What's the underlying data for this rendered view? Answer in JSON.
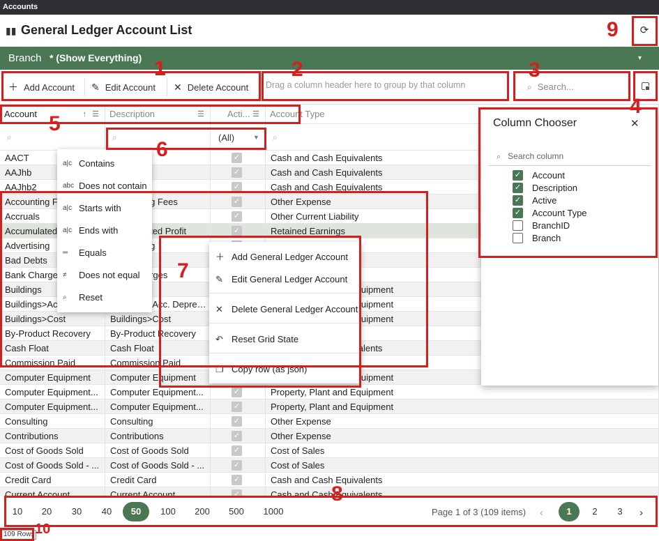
{
  "titlebar": {
    "title": "Accounts"
  },
  "header": {
    "book_icon": "book-icon",
    "title": "General Ledger Account List",
    "refresh_icon": "refresh-icon"
  },
  "branch": {
    "label": "Branch",
    "value": "* (Show Everything)",
    "caret": "▾"
  },
  "toolbar": {
    "add_label": "Add Account",
    "edit_label": "Edit Account",
    "delete_label": "Delete Account",
    "group_hint": "Drag a column header here to group by that column",
    "search_placeholder": "Search..."
  },
  "columns": [
    {
      "label": "Account"
    },
    {
      "label": "Description"
    },
    {
      "label": "Acti..."
    },
    {
      "label": "Account Type"
    }
  ],
  "filter_row": {
    "active_value": "(All)"
  },
  "rows": [
    [
      "AACT",
      "",
      "Cash and Cash Equivalents"
    ],
    [
      "AAJhb",
      "",
      "Cash and Cash Equivalents"
    ],
    [
      "AAJhb2",
      "",
      "Cash and Cash Equivalents"
    ],
    [
      "Accounting Fees",
      "Accounting Fees",
      "Other Expense"
    ],
    [
      "Accruals",
      "",
      "Other Current Liability"
    ],
    [
      "Accumulated Profit",
      "Accumulated Profit",
      "Retained Earnings"
    ],
    [
      "Advertising",
      "Advertising",
      "Other Expense"
    ],
    [
      "Bad Debts",
      "",
      ""
    ],
    [
      "Bank Charges",
      "Bank Charges",
      ""
    ],
    [
      "Buildings",
      "",
      "Property, Plant and Equipment"
    ],
    [
      "Buildings>Acc. Depreciation",
      "Buildings>Acc. Depreciation",
      "Property, Plant and Equipment"
    ],
    [
      "Buildings>Cost",
      "Buildings>Cost",
      "Property, Plant and Equipment"
    ],
    [
      "By-Product Recovery",
      "By-Product Recovery",
      ""
    ],
    [
      "Cash Float",
      "Cash Float",
      "Cash and Cash Equivalents"
    ],
    [
      "Commission Paid",
      "Commission Paid",
      ""
    ],
    [
      "Computer Equipment",
      "Computer Equipment",
      "Property, Plant and Equipment"
    ],
    [
      "Computer Equipment...",
      "Computer Equipment...",
      "Property, Plant and Equipment"
    ],
    [
      "Computer Equipment...",
      "Computer Equipment...",
      "Property, Plant and Equipment"
    ],
    [
      "Consulting",
      "Consulting",
      "Other Expense"
    ],
    [
      "Contributions",
      "Contributions",
      "Other Expense"
    ],
    [
      "Cost of Goods Sold",
      "Cost of Goods Sold",
      "Cost of Sales"
    ],
    [
      "Cost of Goods Sold - ...",
      "Cost of Goods Sold - ...",
      "Cost of Sales"
    ],
    [
      "Credit Card",
      "Credit Card",
      "Cash and Cash Equivalents"
    ],
    [
      "Current Account",
      "Current Account",
      "Cash and Cash Equivalents"
    ]
  ],
  "filter_menu": [
    {
      "label": "Contains",
      "icon": "contains-icon"
    },
    {
      "label": "Does not contain",
      "icon": "does-not-contain-icon"
    },
    {
      "label": "Starts with",
      "icon": "starts-with-icon"
    },
    {
      "label": "Ends with",
      "icon": "ends-with-icon"
    },
    {
      "label": "Equals",
      "icon": "equals-icon"
    },
    {
      "label": "Does not equal",
      "icon": "not-equal-icon"
    },
    {
      "label": "Reset",
      "icon": "search-icon"
    }
  ],
  "context_menu": [
    {
      "label": "Add General Ledger Account",
      "icon": "plus-icon"
    },
    {
      "label": "Edit General Ledger Account",
      "icon": "pencil-icon"
    },
    {
      "label": "Delete General Ledger Account",
      "icon": "close-icon"
    },
    {
      "label": "Reset Grid State",
      "icon": "undo-icon"
    },
    {
      "label": "Copy row (as json)",
      "icon": "copy-icon"
    }
  ],
  "column_chooser": {
    "title": "Column Chooser",
    "search_placeholder": "Search column",
    "items": [
      {
        "label": "Account",
        "checked": true
      },
      {
        "label": "Description",
        "checked": true
      },
      {
        "label": "Active",
        "checked": true
      },
      {
        "label": "Account Type",
        "checked": true
      },
      {
        "label": "BranchID",
        "checked": false
      },
      {
        "label": "Branch",
        "checked": false
      }
    ]
  },
  "pager": {
    "sizes": [
      "10",
      "20",
      "30",
      "40",
      "50",
      "100",
      "200",
      "500",
      "1000"
    ],
    "active_size": "50",
    "info": "Page 1 of 3 (109 items)",
    "pages": [
      "1",
      "2",
      "3"
    ],
    "active_page": "1"
  },
  "row_count": "109 Rows",
  "annotations": [
    "1",
    "2",
    "3",
    "4",
    "5",
    "6",
    "7",
    "8",
    "9",
    "10"
  ],
  "colors": {
    "brand": "#4a7754",
    "annotation": "#d41f1f",
    "titlebar": "#2f3034"
  }
}
